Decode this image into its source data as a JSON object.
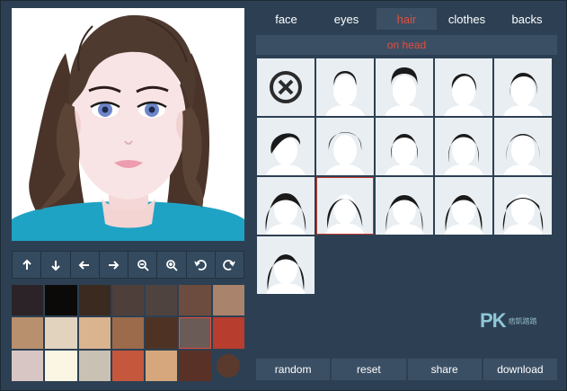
{
  "tabs": [
    {
      "label": "face"
    },
    {
      "label": "eyes"
    },
    {
      "label": "hair",
      "active": true
    },
    {
      "label": "clothes"
    },
    {
      "label": "backs"
    }
  ],
  "subheader": "on head",
  "tools": [
    {
      "icon": "arrow-up-icon"
    },
    {
      "icon": "arrow-down-icon"
    },
    {
      "icon": "arrow-left-icon"
    },
    {
      "icon": "arrow-right-icon"
    },
    {
      "icon": "zoom-out-icon"
    },
    {
      "icon": "zoom-in-icon"
    },
    {
      "icon": "rotate-left-icon"
    },
    {
      "icon": "rotate-right-icon"
    }
  ],
  "palette": {
    "colors": [
      "#2b2327",
      "#0c0a09",
      "#3b2a20",
      "#4e3f3b",
      "#4f433f",
      "#6c4c3e",
      "#a9836b",
      "#b9906d",
      "#e2d3bf",
      "#d9b48f",
      "#9b6b4b",
      "#4e3325",
      "#6b5b56",
      "#b73d2e",
      "#d8c6c4",
      "#fbf5e3",
      "#c9c1b4",
      "#c4573c",
      "#d6a77c",
      "#5a3127",
      "#5b3a2e"
    ],
    "selected_index": 12,
    "round_index": 20
  },
  "hair_styles": {
    "count": 16,
    "selected_index": 11,
    "none_icon": "close-circle-icon"
  },
  "watermark": {
    "brand": "PK",
    "sub": "痞凱踏踏"
  },
  "actions": [
    {
      "label": "random"
    },
    {
      "label": "reset"
    },
    {
      "label": "share"
    },
    {
      "label": "download"
    }
  ]
}
